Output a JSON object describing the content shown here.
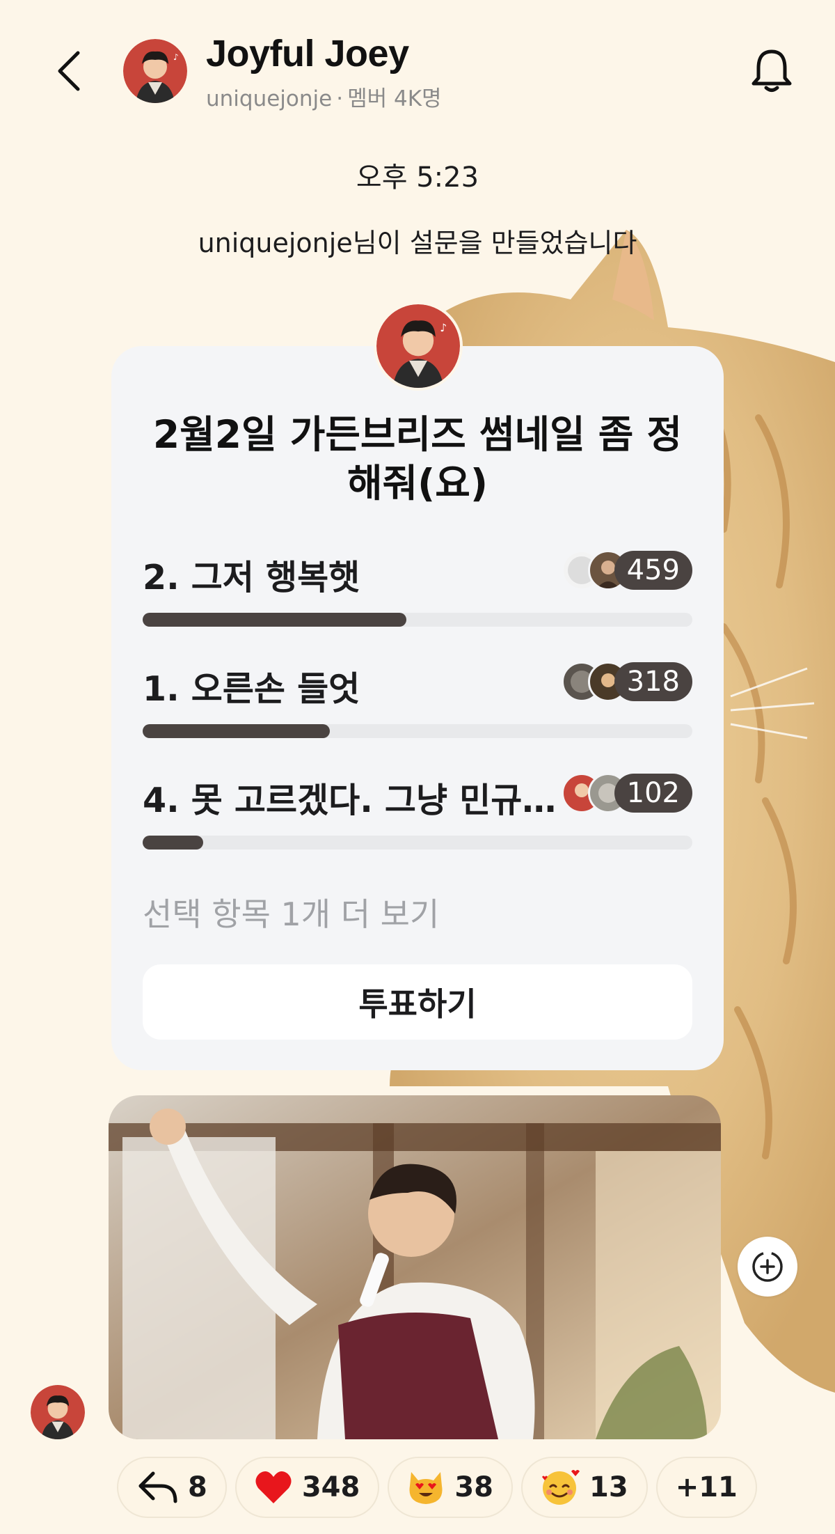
{
  "header": {
    "channel_name": "Joyful Joey",
    "handle": "uniquejonje",
    "separator": "·",
    "members": "멤버 4K명"
  },
  "chat": {
    "time": "오후 5:23",
    "system_message": "uniquejonje님이 설문을 만들었습니다"
  },
  "poll": {
    "title": "2월2일 가든브리즈 썸네일 좀 정해줘(요)",
    "options": [
      {
        "label": "2. 그저 행복햇",
        "count": "459",
        "fraction": 0.48
      },
      {
        "label": "1. 오른손 들엇",
        "count": "318",
        "fraction": 0.34
      },
      {
        "label": "4. 못 고르겠다. 그냥 민규…",
        "count": "102",
        "fraction": 0.11
      }
    ],
    "more_label": "선택 항목 1개 더 보기",
    "vote_label": "투표하기"
  },
  "reactions": [
    {
      "icon": "reply-icon",
      "count": "8"
    },
    {
      "icon": "heart-icon",
      "count": "348"
    },
    {
      "icon": "heart-eyes-cat-icon",
      "count": "38"
    },
    {
      "icon": "smiling-face-with-hearts-icon",
      "count": "13"
    },
    {
      "icon": "",
      "count": "+11"
    }
  ],
  "colors": {
    "background": "#fdf6e9",
    "card": "#f4f5f7",
    "bar_fill": "#4a4341",
    "bar_track": "#e8e9eb",
    "heart": "#e8161c",
    "avatar_red": "#c8453a"
  }
}
